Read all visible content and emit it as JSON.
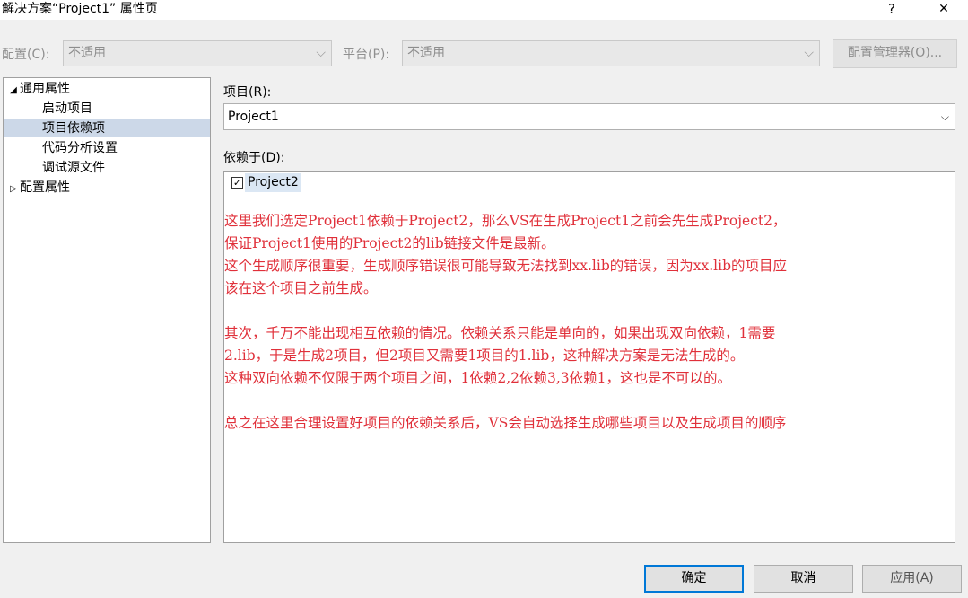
{
  "window": {
    "title": "解决方案“Project1” 属性页",
    "help": "?",
    "close": "✕"
  },
  "toolbar": {
    "config_label": "配置(C):",
    "config_value": "不适用",
    "platform_label": "平台(P):",
    "platform_value": "不适用",
    "config_manager": "配置管理器(O)..."
  },
  "tree": {
    "items": [
      {
        "label": "通用属性",
        "expanded": true
      },
      {
        "label": "启动项目"
      },
      {
        "label": "项目依赖项",
        "selected": true
      },
      {
        "label": "代码分析设置"
      },
      {
        "label": "调试源文件"
      },
      {
        "label": "配置属性",
        "expanded": false
      }
    ]
  },
  "main": {
    "project_label": "项目(R):",
    "project_value": "Project1",
    "depends_label": "依赖于(D):",
    "depends_items": [
      {
        "label": "Project2",
        "checked": true
      }
    ]
  },
  "notes": [
    "这里我们选定Project1依赖于Project2，那么VS在生成Project1之前会先生成Project2，",
    "保证Project1使用的Project2的lib链接文件是最新。",
    "这个生成顺序很重要，生成顺序错误很可能导致无法找到xx.lib的错误，因为xx.lib的项目应",
    "该在这个项目之前生成。",
    "其次，千万不能出现相互依赖的情况。依赖关系只能是单向的，如果出现双向依赖，1需要",
    "2.lib，于是生成2项目，但2项目又需要1项目的1.lib，这种解决方案是无法生成的。",
    "这种双向依赖不仅限于两个项目之间，1依赖2,2依赖3,3依赖1，这也是不可以的。",
    "总之在这里合理设置好项目的依赖关系后，VS会自动选择生成哪些项目以及生成项目的顺序"
  ],
  "buttons": {
    "ok": "确定",
    "cancel": "取消",
    "apply": "应用(A)"
  },
  "colors": {
    "note_text": "#e0303a",
    "selection": "#ccd8e8",
    "default_button_border": "#0078d7"
  }
}
